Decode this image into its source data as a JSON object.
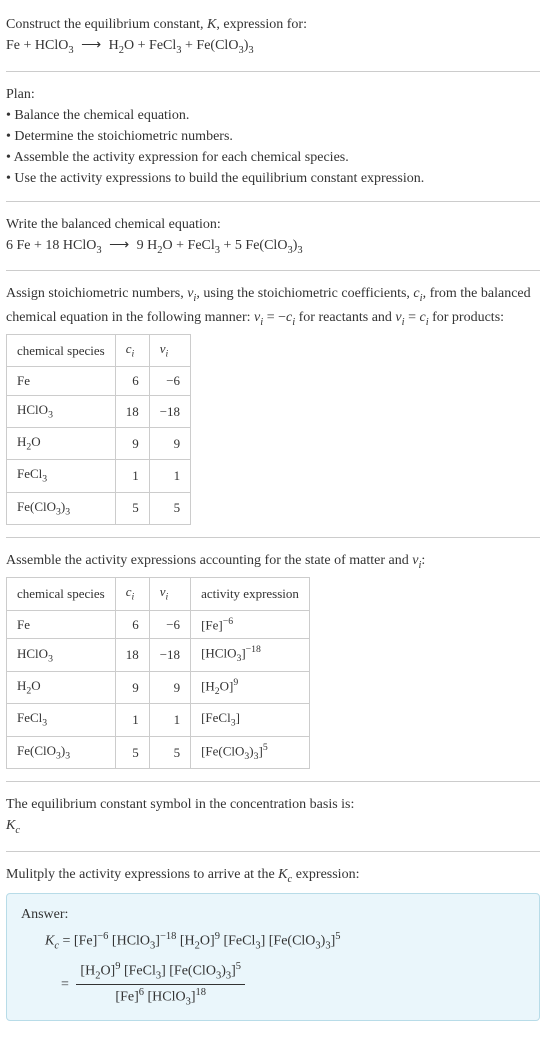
{
  "header": {
    "line1_prefix": "Construct the equilibrium constant, ",
    "line1_k": "K",
    "line1_suffix": ", expression for:",
    "eq_lhs_fe": "Fe + HClO",
    "eq_lhs_sub3": "3",
    "eq_arrow": "⟶",
    "eq_rhs_h": "H",
    "eq_rhs_2": "2",
    "eq_rhs_o_fecl": "O + FeCl",
    "eq_rhs_3a": "3",
    "eq_rhs_feclo": " + Fe(ClO",
    "eq_rhs_3b": "3",
    "eq_rhs_close": ")",
    "eq_rhs_3c": "3"
  },
  "plan": {
    "title": "Plan:",
    "b1": "• Balance the chemical equation.",
    "b2": "• Determine the stoichiometric numbers.",
    "b3": "• Assemble the activity expression for each chemical species.",
    "b4": "• Use the activity expressions to build the equilibrium constant expression."
  },
  "balanced": {
    "title": "Write the balanced chemical equation:",
    "lhs": "6 Fe + 18 HClO",
    "lhs_3": "3",
    "arrow": "⟶",
    "rhs_a": "9 H",
    "rhs_2": "2",
    "rhs_b": "O + FeCl",
    "rhs_3a": "3",
    "rhs_c": " + 5 Fe(ClO",
    "rhs_3b": "3",
    "rhs_close": ")",
    "rhs_3c": "3"
  },
  "assign": {
    "p1": "Assign stoichiometric numbers, ",
    "vi": "ν",
    "i": "i",
    "p2": ", using the stoichiometric coefficients, ",
    "ci": "c",
    "p3": ", from the balanced chemical equation in the following manner: ",
    "eq1a": "ν",
    "eq1b": " = −",
    "eq1c": "c",
    "p4": " for reactants and ",
    "eq2a": "ν",
    "eq2b": " = ",
    "eq2c": "c",
    "p5": " for products:"
  },
  "table1": {
    "h1": "chemical species",
    "h2": "c",
    "h2i": "i",
    "h3": "ν",
    "h3i": "i",
    "rows": [
      {
        "sp_a": "Fe",
        "sp_b": "",
        "c": "6",
        "v": "−6"
      },
      {
        "sp_a": "HClO",
        "sp_b": "3",
        "c": "18",
        "v": "−18"
      },
      {
        "sp_a": "H",
        "sp_b": "2",
        "sp_c": "O",
        "c": "9",
        "v": "9"
      },
      {
        "sp_a": "FeCl",
        "sp_b": "3",
        "c": "1",
        "v": "1"
      },
      {
        "sp_a": "Fe(ClO",
        "sp_b": "3",
        "sp_c": ")",
        "sp_d": "3",
        "c": "5",
        "v": "5"
      }
    ]
  },
  "assemble": {
    "p1": "Assemble the activity expressions accounting for the state of matter and ",
    "v": "ν",
    "vi": "i",
    "p2": ":"
  },
  "table2": {
    "h1": "chemical species",
    "h2": "c",
    "h2i": "i",
    "h3": "ν",
    "h3i": "i",
    "h4": "activity expression",
    "rows": [
      {
        "sp": "Fe",
        "c": "6",
        "v": "−6",
        "ae_a": "[Fe]",
        "ae_sup": "−6"
      },
      {
        "sp": "HClO3",
        "c": "18",
        "v": "−18",
        "ae_a": "[HClO",
        "ae_sub": "3",
        "ae_b": "]",
        "ae_sup": "−18"
      },
      {
        "sp": "H2O",
        "c": "9",
        "v": "9",
        "ae_a": "[H",
        "ae_sub": "2",
        "ae_b": "O]",
        "ae_sup": "9"
      },
      {
        "sp": "FeCl3",
        "c": "1",
        "v": "1",
        "ae_a": "[FeCl",
        "ae_sub": "3",
        "ae_b": "]"
      },
      {
        "sp": "Fe(ClO3)3",
        "c": "5",
        "v": "5",
        "ae_a": "[Fe(ClO",
        "ae_sub": "3",
        "ae_b": ")",
        "ae_sub2": "3",
        "ae_c": "]",
        "ae_sup": "5"
      }
    ]
  },
  "kcsymbol": {
    "line1": "The equilibrium constant symbol in the concentration basis is:",
    "k": "K",
    "c": "c"
  },
  "multiply": {
    "p1": "Mulitply the activity expressions to arrive at the ",
    "k": "K",
    "c": "c",
    "p2": " expression:"
  },
  "answer": {
    "label": "Answer:",
    "kc_k": "K",
    "kc_c": "c",
    "eq": " = ",
    "line1_a": "[Fe]",
    "line1_sup1": "−6",
    "line1_b": " [HClO",
    "line1_sub1": "3",
    "line1_c": "]",
    "line1_sup2": "−18",
    "line1_d": " [H",
    "line1_sub2": "2",
    "line1_e": "O]",
    "line1_sup3": "9",
    "line1_f": " [FeCl",
    "line1_sub3": "3",
    "line1_g": "] [Fe(ClO",
    "line1_sub4": "3",
    "line1_h": ")",
    "line1_sub5": "3",
    "line1_i": "]",
    "line1_sup4": "5",
    "eq2": "= ",
    "num_a": "[H",
    "num_sub1": "2",
    "num_b": "O]",
    "num_sup1": "9",
    "num_c": " [FeCl",
    "num_sub2": "3",
    "num_d": "] [Fe(ClO",
    "num_sub3": "3",
    "num_e": ")",
    "num_sub4": "3",
    "num_f": "]",
    "num_sup2": "5",
    "den_a": "[Fe]",
    "den_sup1": "6",
    "den_b": " [HClO",
    "den_sub1": "3",
    "den_c": "]",
    "den_sup2": "18"
  }
}
